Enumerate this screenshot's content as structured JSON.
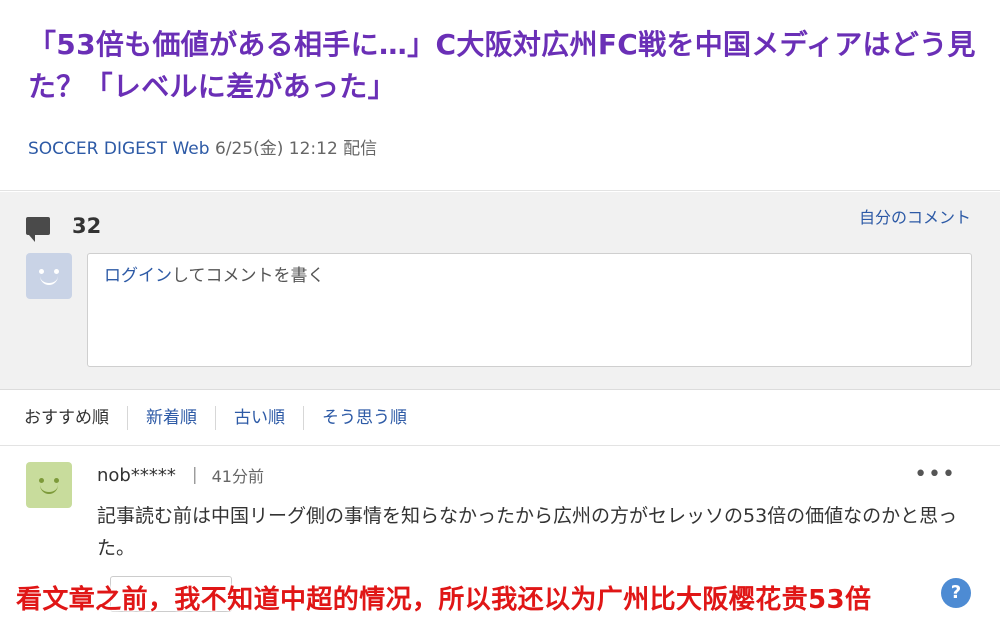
{
  "article": {
    "headline": "「53倍も価値がある相手に…」C大阪対広州FC戦を中国メディアはどう見た？「レベルに差があった」",
    "source": "SOCCER DIGEST Web",
    "date": "6/25(金) 12:12 配信"
  },
  "comments": {
    "count": "32",
    "my_comments_link": "自分のコメント",
    "login_link": "ログイン",
    "composer_placeholder": "してコメントを書く",
    "sort": {
      "recommended": "おすすめ順",
      "newest": "新着順",
      "oldest": "古い順",
      "agree": "そう思う順"
    },
    "items": [
      {
        "username": "nob*****",
        "separator": "|",
        "time": "41分前",
        "more": "•••",
        "text": "記事読む前は中国リーグ側の事情を知らなかったから広州の方がセレッソの53倍の価値なのかと思った。"
      }
    ]
  },
  "overlay_caption": "看文章之前，我不知道中超的情况，所以我还以为广州比大阪樱花贵53倍",
  "help_glyph": "?",
  "colors": {
    "headline": "#6a2fb6",
    "link": "#2d5aa6",
    "caption": "#e01616",
    "panel_bg": "#f1f1f1"
  }
}
